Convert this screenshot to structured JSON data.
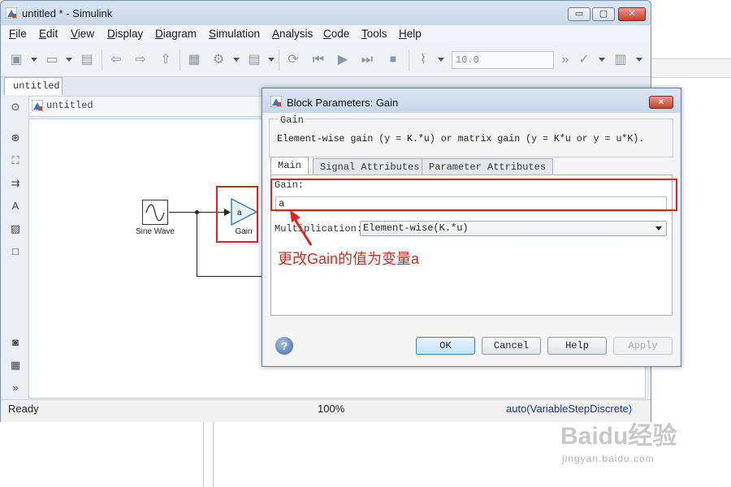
{
  "window": {
    "title": "untitled * - Simulink",
    "minimize": "▭",
    "maximize": "▢",
    "close": "✕"
  },
  "menu": [
    {
      "key": "F",
      "rest": "ile"
    },
    {
      "key": "E",
      "rest": "dit"
    },
    {
      "key": "V",
      "rest": "iew"
    },
    {
      "key": "D",
      "rest": "isplay"
    },
    {
      "key": "D",
      "rest": "iagram"
    },
    {
      "key": "S",
      "rest": "imulation"
    },
    {
      "key": "A",
      "rest": "nalysis"
    },
    {
      "key": "C",
      "rest": "ode"
    },
    {
      "key": "T",
      "rest": "ools"
    },
    {
      "key": "H",
      "rest": "elp"
    }
  ],
  "toolbar": {
    "stop_time": "10.0",
    "more": "»"
  },
  "model_tab": "untitled",
  "breadcrumb": "untitled",
  "palette_more": "»",
  "blocks": {
    "sine_label": "Sine Wave",
    "gain_label": "Gain",
    "gain_value": "a"
  },
  "status": {
    "ready": "Ready",
    "zoom": "100%",
    "solver": "auto(VariableStepDiscrete)"
  },
  "dialog": {
    "title": "Block Parameters: Gain",
    "close": "✕",
    "group_title": "Gain",
    "description": "Element-wise gain (y = K.*u) or matrix gain (y = K*u or y = u*K).",
    "tabs": [
      "Main",
      "Signal Attributes",
      "Parameter Attributes"
    ],
    "gain_label": "Gain:",
    "gain_value": "a",
    "multiplication_label": "Multiplication:",
    "multiplication_value": "Element-wise(K.*u)",
    "help_glyph": "?",
    "buttons": {
      "ok": "OK",
      "cancel": "Cancel",
      "help": "Help",
      "apply": "Apply"
    }
  },
  "annotation": "更改Gain的值为变量a",
  "watermark": {
    "logo": "Baidu经验",
    "url": "jingyan.baidu.com"
  },
  "colors": {
    "highlight": "#e0231b",
    "status_solver": "#1a3b8c"
  }
}
